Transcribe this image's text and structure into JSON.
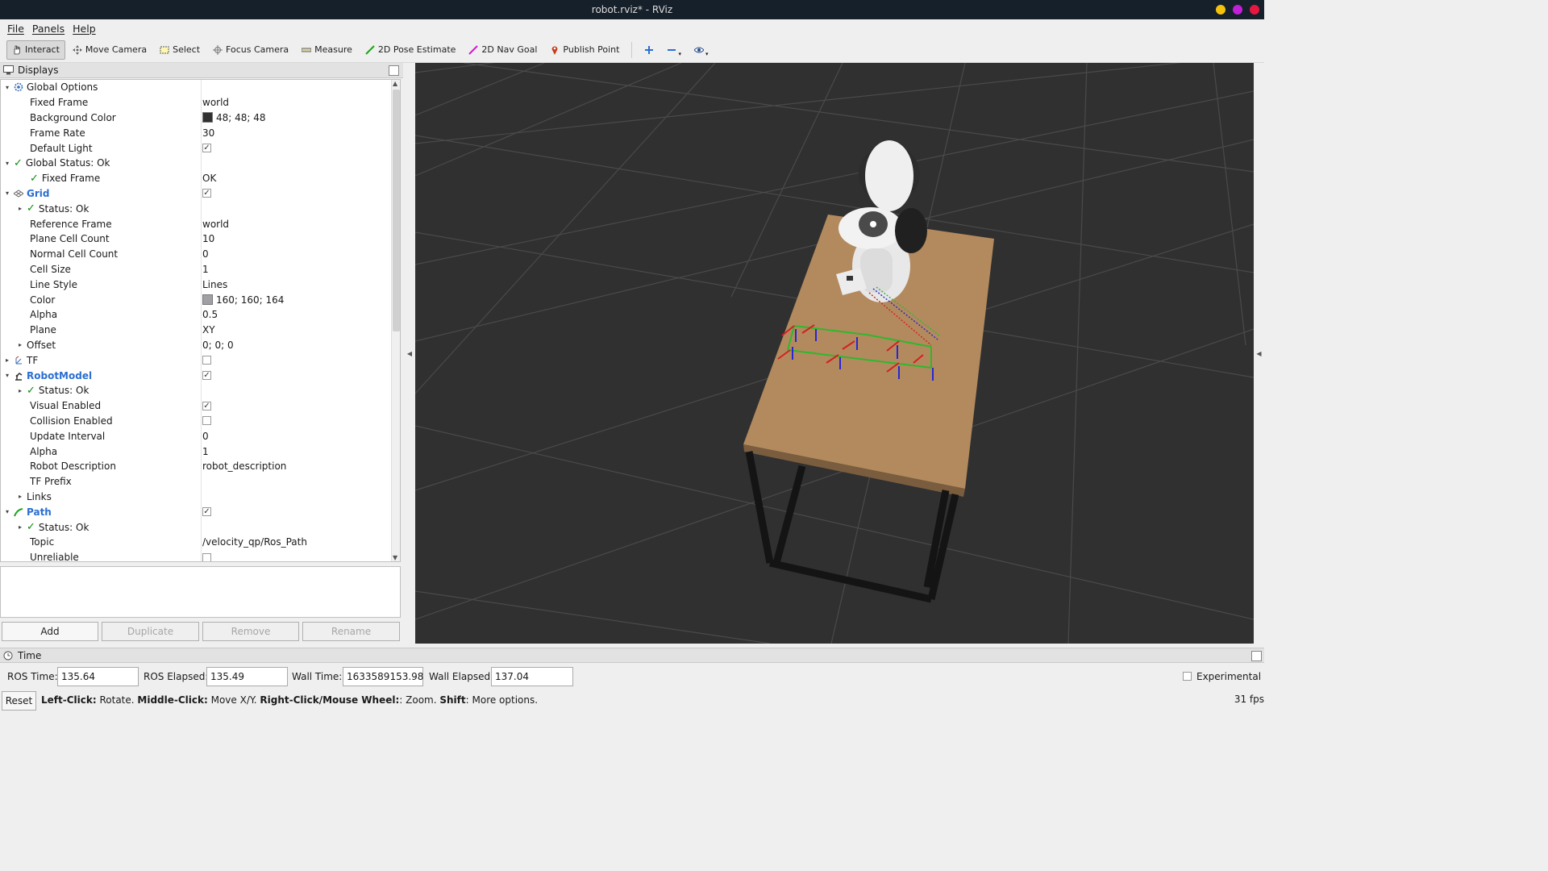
{
  "window": {
    "title": "robot.rviz* - RViz"
  },
  "menu": [
    "File",
    "Panels",
    "Help"
  ],
  "toolbar": {
    "tools": [
      {
        "label": "Interact",
        "icon": "hand-icon"
      },
      {
        "label": "Move Camera",
        "icon": "move-camera-icon"
      },
      {
        "label": "Select",
        "icon": "select-icon"
      },
      {
        "label": "Focus Camera",
        "icon": "focus-camera-icon"
      },
      {
        "label": "Measure",
        "icon": "ruler-icon"
      },
      {
        "label": "2D Pose Estimate",
        "icon": "pose-estimate-icon"
      },
      {
        "label": "2D Nav Goal",
        "icon": "nav-goal-icon"
      },
      {
        "label": "Publish Point",
        "icon": "map-pin-icon"
      }
    ],
    "extra_icons": [
      "add-tool-icon",
      "remove-tool-icon",
      "eye-icon"
    ]
  },
  "displays": {
    "title": "Displays",
    "rows": [
      {
        "key": "Global Options",
        "value": ""
      },
      {
        "key": "Fixed Frame",
        "value": "world"
      },
      {
        "key": "Background Color",
        "value": "48; 48; 48"
      },
      {
        "key": "Frame Rate",
        "value": "30"
      },
      {
        "key": "Default Light",
        "value": ""
      },
      {
        "key": "Global Status: Ok",
        "value": ""
      },
      {
        "key": "Fixed Frame",
        "value": "OK"
      },
      {
        "key": "Grid",
        "value": ""
      },
      {
        "key": "Status: Ok",
        "value": ""
      },
      {
        "key": "Reference Frame",
        "value": "world"
      },
      {
        "key": "Plane Cell Count",
        "value": "10"
      },
      {
        "key": "Normal Cell Count",
        "value": "0"
      },
      {
        "key": "Cell Size",
        "value": "1"
      },
      {
        "key": "Line Style",
        "value": "Lines"
      },
      {
        "key": "Color",
        "value": "160; 160; 164"
      },
      {
        "key": "Alpha",
        "value": "0.5"
      },
      {
        "key": "Plane",
        "value": "XY"
      },
      {
        "key": "Offset",
        "value": "0; 0; 0"
      },
      {
        "key": "TF",
        "value": ""
      },
      {
        "key": "RobotModel",
        "value": ""
      },
      {
        "key": "Status: Ok",
        "value": ""
      },
      {
        "key": "Visual Enabled",
        "value": ""
      },
      {
        "key": "Collision Enabled",
        "value": ""
      },
      {
        "key": "Update Interval",
        "value": "0"
      },
      {
        "key": "Alpha",
        "value": "1"
      },
      {
        "key": "Robot Description",
        "value": "robot_description"
      },
      {
        "key": "TF Prefix",
        "value": ""
      },
      {
        "key": "Links",
        "value": ""
      },
      {
        "key": "Path",
        "value": ""
      },
      {
        "key": "Status: Ok",
        "value": ""
      },
      {
        "key": "Topic",
        "value": "/velocity_qp/Ros_Path"
      },
      {
        "key": "Unreliable",
        "value": ""
      }
    ],
    "buttons": [
      "Add",
      "Duplicate",
      "Remove",
      "Rename"
    ]
  },
  "colors": {
    "background": "#303030",
    "grid": "#a0a0a4"
  },
  "time": {
    "title": "Time",
    "ros_time_label": "ROS Time:",
    "ros_time": "135.64",
    "ros_elapsed_label": "ROS Elapsed:",
    "ros_elapsed": "135.49",
    "wall_time_label": "Wall Time:",
    "wall_time": "1633589153.98",
    "wall_elapsed_label": "Wall Elapsed:",
    "wall_elapsed": "137.04",
    "experimental_label": "Experimental"
  },
  "status": {
    "reset_label": "Reset",
    "hint_parts": [
      {
        "b": "Left-Click:",
        "t": " Rotate. "
      },
      {
        "b": "Middle-Click:",
        "t": " Move X/Y. "
      },
      {
        "b": "Right-Click/Mouse Wheel:",
        "t": ": Zoom. "
      },
      {
        "b": "Shift",
        "t": ": More options."
      }
    ],
    "fps": "31 fps"
  }
}
